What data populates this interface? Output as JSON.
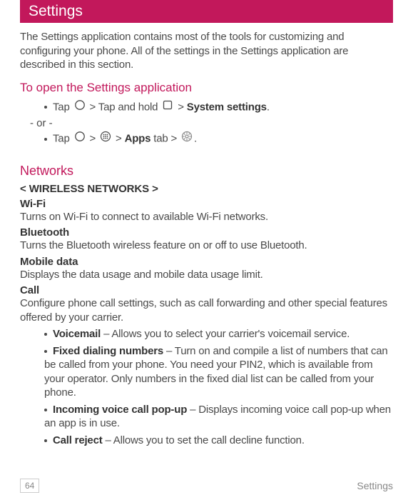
{
  "title": "Settings",
  "intro": "The Settings application contains most of the tools for customizing and configuring your phone. All of the settings in the Settings application are described in this section.",
  "open_heading": "To open the Settings application",
  "step1_pre": "Tap ",
  "step1_mid1": " > Tap and hold ",
  "step1_mid2": " > ",
  "step1_bold": "System settings",
  "step1_end": ".",
  "or_text": "- or -",
  "step2_pre": "Tap ",
  "step2_gt1": " > ",
  "step2_gt2": " > ",
  "step2_bold": "Apps",
  "step2_tab": " tab > ",
  "step2_end": ".",
  "networks_heading": "Networks",
  "wireless_heading": "< WIRELESS NETWORKS >",
  "wifi_title": "Wi-Fi",
  "wifi_desc": "Turns on Wi-Fi to connect to available Wi-Fi networks.",
  "bt_title": "Bluetooth",
  "bt_desc": "Turns the Bluetooth wireless feature on or off to use Bluetooth.",
  "md_title": "Mobile data",
  "md_desc": "Displays the data usage and mobile data usage limit.",
  "call_title": "Call",
  "call_desc": "Configure phone call settings, such as call forwarding and other special features offered by your carrier.",
  "items": [
    {
      "bold": "Voicemail",
      "rest": " – Allows you to select your carrier's voicemail service."
    },
    {
      "bold": "Fixed dialing numbers",
      "rest": " – Turn on and compile a list of numbers that can be called from your phone. You need your PIN2, which is available from your operator. Only numbers in the fixed dial list can be called from your phone."
    },
    {
      "bold": "Incoming voice call pop-up",
      "rest": " – Displays incoming voice call pop-up when an app is in use."
    },
    {
      "bold": "Call reject",
      "rest": " – Allows you to set the call decline function."
    }
  ],
  "page_number": "64",
  "footer_label": "Settings"
}
